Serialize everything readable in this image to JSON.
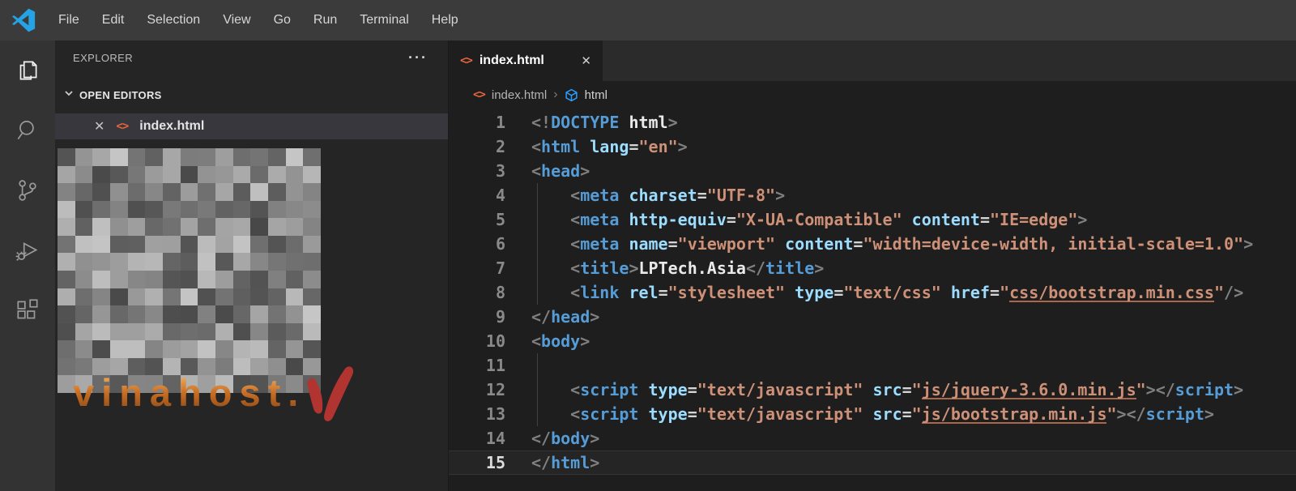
{
  "menu_bar": {
    "items": [
      "File",
      "Edit",
      "Selection",
      "View",
      "Go",
      "Run",
      "Terminal",
      "Help"
    ]
  },
  "activity_bar": {
    "items": [
      {
        "icon": "files-icon",
        "active": true
      },
      {
        "icon": "search-icon",
        "active": false
      },
      {
        "icon": "source-control-icon",
        "active": false
      },
      {
        "icon": "run-debug-icon",
        "active": false
      },
      {
        "icon": "extensions-icon",
        "active": false
      }
    ]
  },
  "sidebar": {
    "title": "EXPLORER",
    "more_actions": "···",
    "open_editors": {
      "label": "OPEN EDITORS",
      "items": [
        {
          "close": "✕",
          "icon": "<>",
          "file": "index.html",
          "selected": true
        }
      ]
    },
    "file_tree_censored": true,
    "watermark": {
      "text": "vinahost."
    }
  },
  "editor": {
    "tab": {
      "icon": "<>",
      "label": "index.html",
      "close": "✕",
      "active": true
    },
    "breadcrumb": {
      "icon": "<>",
      "file": "index.html",
      "separator": "›",
      "symbol": "html"
    },
    "code": {
      "language": "html",
      "current_line": 15,
      "lines": [
        {
          "n": 1,
          "g": false,
          "t": [
            [
              "p",
              "<!"
            ],
            [
              "t",
              "DOCTYPE"
            ],
            [
              "w",
              " "
            ],
            [
              "b",
              "html"
            ],
            [
              "p",
              ">"
            ]
          ]
        },
        {
          "n": 2,
          "g": false,
          "t": [
            [
              "p",
              "<"
            ],
            [
              "t",
              "html"
            ],
            [
              "w",
              " "
            ],
            [
              "a",
              "lang"
            ],
            [
              "w",
              "="
            ],
            [
              "s",
              "\"en\""
            ],
            [
              "p",
              ">"
            ]
          ]
        },
        {
          "n": 3,
          "g": false,
          "t": [
            [
              "p",
              "<"
            ],
            [
              "t",
              "head"
            ],
            [
              "p",
              ">"
            ]
          ]
        },
        {
          "n": 4,
          "g": true,
          "t": [
            [
              "w",
              "    "
            ],
            [
              "p",
              "<"
            ],
            [
              "t",
              "meta"
            ],
            [
              "w",
              " "
            ],
            [
              "a",
              "charset"
            ],
            [
              "w",
              "="
            ],
            [
              "s",
              "\"UTF-8\""
            ],
            [
              "p",
              ">"
            ]
          ]
        },
        {
          "n": 5,
          "g": true,
          "t": [
            [
              "w",
              "    "
            ],
            [
              "p",
              "<"
            ],
            [
              "t",
              "meta"
            ],
            [
              "w",
              " "
            ],
            [
              "a",
              "http-equiv"
            ],
            [
              "w",
              "="
            ],
            [
              "s",
              "\"X-UA-Compatible\""
            ],
            [
              "w",
              " "
            ],
            [
              "a",
              "content"
            ],
            [
              "w",
              "="
            ],
            [
              "s",
              "\"IE=edge\""
            ],
            [
              "p",
              ">"
            ]
          ]
        },
        {
          "n": 6,
          "g": true,
          "t": [
            [
              "w",
              "    "
            ],
            [
              "p",
              "<"
            ],
            [
              "t",
              "meta"
            ],
            [
              "w",
              " "
            ],
            [
              "a",
              "name"
            ],
            [
              "w",
              "="
            ],
            [
              "s",
              "\"viewport\""
            ],
            [
              "w",
              " "
            ],
            [
              "a",
              "content"
            ],
            [
              "w",
              "="
            ],
            [
              "s",
              "\"width=device-width, initial-scale=1.0\""
            ],
            [
              "p",
              ">"
            ]
          ]
        },
        {
          "n": 7,
          "g": true,
          "t": [
            [
              "w",
              "    "
            ],
            [
              "p",
              "<"
            ],
            [
              "t",
              "title"
            ],
            [
              "p",
              ">"
            ],
            [
              "b",
              "LPTech.Asia"
            ],
            [
              "p",
              "<"
            ],
            [
              "p",
              "/"
            ],
            [
              "t",
              "title"
            ],
            [
              "p",
              ">"
            ]
          ]
        },
        {
          "n": 8,
          "g": true,
          "t": [
            [
              "w",
              "    "
            ],
            [
              "p",
              "<"
            ],
            [
              "t",
              "link"
            ],
            [
              "w",
              " "
            ],
            [
              "a",
              "rel"
            ],
            [
              "w",
              "="
            ],
            [
              "s",
              "\"stylesheet\""
            ],
            [
              "w",
              " "
            ],
            [
              "a",
              "type"
            ],
            [
              "w",
              "="
            ],
            [
              "s",
              "\"text/css\""
            ],
            [
              "w",
              " "
            ],
            [
              "a",
              "href"
            ],
            [
              "w",
              "="
            ],
            [
              "s",
              "\""
            ],
            [
              "sl",
              "css/bootstrap.min.css"
            ],
            [
              "s",
              "\""
            ],
            [
              "p",
              "/>"
            ]
          ]
        },
        {
          "n": 9,
          "g": false,
          "t": [
            [
              "p",
              "<"
            ],
            [
              "p",
              "/"
            ],
            [
              "t",
              "head"
            ],
            [
              "p",
              ">"
            ]
          ]
        },
        {
          "n": 10,
          "g": false,
          "t": [
            [
              "p",
              "<"
            ],
            [
              "t",
              "body"
            ],
            [
              "p",
              ">"
            ]
          ]
        },
        {
          "n": 11,
          "g": true,
          "t": []
        },
        {
          "n": 12,
          "g": true,
          "t": [
            [
              "w",
              "    "
            ],
            [
              "p",
              "<"
            ],
            [
              "t",
              "script"
            ],
            [
              "w",
              " "
            ],
            [
              "a",
              "type"
            ],
            [
              "w",
              "="
            ],
            [
              "s",
              "\"text/javascript\""
            ],
            [
              "w",
              " "
            ],
            [
              "a",
              "src"
            ],
            [
              "w",
              "="
            ],
            [
              "s",
              "\""
            ],
            [
              "sl",
              "js/jquery-3.6.0.min.js"
            ],
            [
              "s",
              "\""
            ],
            [
              "p",
              ">"
            ],
            [
              "p",
              "<"
            ],
            [
              "p",
              "/"
            ],
            [
              "t",
              "script"
            ],
            [
              "p",
              ">"
            ]
          ]
        },
        {
          "n": 13,
          "g": true,
          "t": [
            [
              "w",
              "    "
            ],
            [
              "p",
              "<"
            ],
            [
              "t",
              "script"
            ],
            [
              "w",
              " "
            ],
            [
              "a",
              "type"
            ],
            [
              "w",
              "="
            ],
            [
              "s",
              "\"text/javascript\""
            ],
            [
              "w",
              " "
            ],
            [
              "a",
              "src"
            ],
            [
              "w",
              "="
            ],
            [
              "s",
              "\""
            ],
            [
              "sl",
              "js/bootstrap.min.js"
            ],
            [
              "s",
              "\""
            ],
            [
              "p",
              ">"
            ],
            [
              "p",
              "<"
            ],
            [
              "p",
              "/"
            ],
            [
              "t",
              "script"
            ],
            [
              "p",
              ">"
            ]
          ]
        },
        {
          "n": 14,
          "g": false,
          "t": [
            [
              "p",
              "<"
            ],
            [
              "p",
              "/"
            ],
            [
              "t",
              "body"
            ],
            [
              "p",
              ">"
            ]
          ]
        },
        {
          "n": 15,
          "g": false,
          "current": true,
          "t": [
            [
              "p",
              "<"
            ],
            [
              "p",
              "/"
            ],
            [
              "t",
              "html"
            ],
            [
              "p",
              ">"
            ]
          ]
        }
      ]
    }
  },
  "colors": {
    "titlebar": "#3b3b3b",
    "activitybar": "#333333",
    "sidebar": "#252526",
    "editor": "#1e1e1e",
    "selected_row": "#37373d",
    "logo_blue": "#24a3e6",
    "html_icon_orange": "#e8653a",
    "syntax_tag": "#569cd6",
    "syntax_attribute": "#9cdcfe",
    "syntax_string": "#ce9178",
    "syntax_punctuation": "#808080",
    "syntax_text": "#d4d4d4",
    "watermark_orange": "#d98b3f",
    "watermark_red": "#b23431",
    "breadcrumb_symbol_blue": "#2b9eff"
  }
}
